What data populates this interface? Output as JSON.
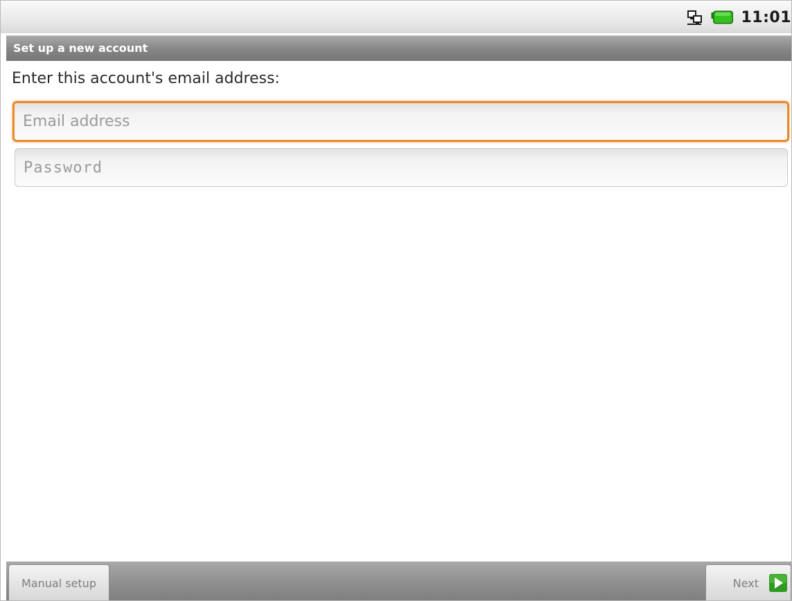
{
  "status_bar": {
    "clock": "11:01",
    "icons": [
      "network-icon",
      "battery-icon"
    ],
    "battery_color": "#2fae1f"
  },
  "title_bar": {
    "title": "Set up a new account"
  },
  "form": {
    "prompt": "Enter this account's email address:",
    "email": {
      "value": "",
      "placeholder": "Email address"
    },
    "password": {
      "value": "",
      "placeholder": "Password"
    },
    "focus_color": "#e98a2a"
  },
  "bottom_bar": {
    "manual_setup_label": "Manual setup",
    "next_label": "Next",
    "next_icon": "arrow-right-icon",
    "next_icon_color": "#3ba82b"
  }
}
